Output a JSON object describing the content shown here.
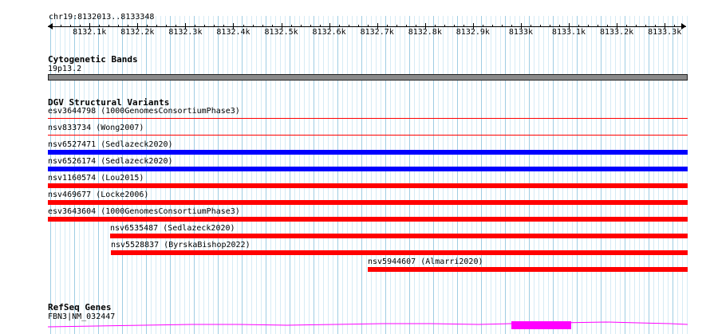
{
  "ruler": {
    "position": "chr19:8132013..8133348",
    "ticks": [
      "8132.1k",
      "8132.2k",
      "8132.3k",
      "8132.4k",
      "8132.5k",
      "8132.6k",
      "8132.7k",
      "8132.8k",
      "8132.9k",
      "8133k",
      "8133.1k",
      "8133.2k",
      "8133.3k"
    ]
  },
  "cytobands": {
    "title": "Cytogenetic Bands",
    "band_label": "19p13.2"
  },
  "dgv": {
    "title": "DGV Structural Variants",
    "colors": {
      "red": "#ff0000",
      "blue": "#0000ff"
    },
    "tracks": [
      {
        "label": "esv3644798 (1000GenomesConsortiumPhase3)",
        "color": "red",
        "style": "thin",
        "start_kb": 8132.013,
        "end_kb": 8133.348
      },
      {
        "label": "nsv833734 (Wong2007)",
        "color": "red",
        "style": "thin",
        "start_kb": 8132.013,
        "end_kb": 8133.348
      },
      {
        "label": "nsv6527471 (Sedlazeck2020)",
        "color": "blue",
        "style": "thick",
        "start_kb": 8132.013,
        "end_kb": 8133.348
      },
      {
        "label": "nsv6526174 (Sedlazeck2020)",
        "color": "blue",
        "style": "thick",
        "start_kb": 8132.013,
        "end_kb": 8133.348
      },
      {
        "label": "nsv1160574 (Lou2015)",
        "color": "red",
        "style": "thick",
        "start_kb": 8132.013,
        "end_kb": 8133.348
      },
      {
        "label": "nsv469677 (Locke2006)",
        "color": "red",
        "style": "thick",
        "start_kb": 8132.013,
        "end_kb": 8133.348
      },
      {
        "label": "esv3643604 (1000GenomesConsortiumPhase3)",
        "color": "red",
        "style": "thick",
        "start_kb": 8132.013,
        "end_kb": 8133.348
      },
      {
        "label": "nsv6535487 (Sedlazeck2020)",
        "color": "red",
        "style": "thick",
        "start_kb": 8132.143,
        "end_kb": 8133.348
      },
      {
        "label": "nsv5528837 (ByrskaBishop2022)",
        "color": "red",
        "style": "thick",
        "start_kb": 8132.145,
        "end_kb": 8133.348
      },
      {
        "label": "nsv5944607 (Almarri2020)",
        "color": "red",
        "style": "thick",
        "start_kb": 8132.68,
        "end_kb": 8133.348
      }
    ]
  },
  "refseq": {
    "title": "RefSeq Genes",
    "gene_label": "FBN3|NM_032447",
    "color": "#ff00ff"
  }
}
